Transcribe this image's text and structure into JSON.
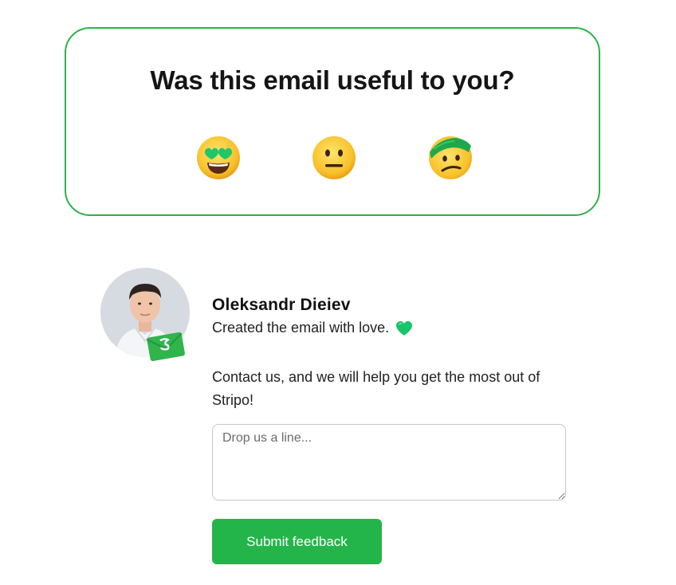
{
  "survey": {
    "title": "Was this email useful to you?",
    "options": [
      {
        "icon": "heart-eyes-emoji-icon"
      },
      {
        "icon": "neutral-face-emoji-icon"
      },
      {
        "icon": "bandaged-face-emoji-icon"
      }
    ],
    "accent": "#2cb34a"
  },
  "author": {
    "name": "Oleksandr Dieiev",
    "tagline": "Created the email with love.",
    "heart_icon": "green-heart-icon",
    "avatar_icon": "avatar-photo",
    "badge_icon": "stripo-envelope-badge-icon"
  },
  "contact": {
    "text": "Contact us, and we will help you get the most out of Stripo!"
  },
  "feedback": {
    "placeholder": "Drop us a line...",
    "value": ""
  },
  "submit": {
    "label": "Submit feedback",
    "color": "#24b54a"
  }
}
